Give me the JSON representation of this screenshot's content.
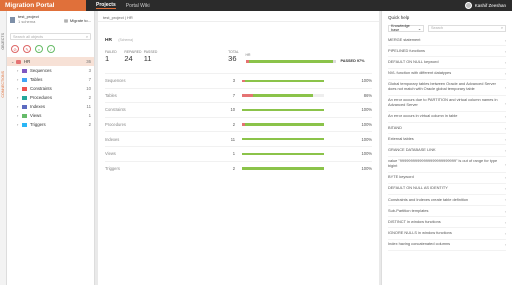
{
  "app": {
    "title": "Migration Portal"
  },
  "nav": [
    {
      "label": "Projects"
    },
    {
      "label": "Portal Wiki"
    }
  ],
  "user": {
    "name": "Kashif Zeeshan"
  },
  "side_tabs": [
    "OBJECTS",
    "CONNECTIONS"
  ],
  "project": {
    "name": "test_project",
    "sub": "1 schema",
    "migrate_label": "Migrate to..."
  },
  "search": {
    "placeholder": "Search all objects"
  },
  "tree": {
    "root": {
      "label": "HR",
      "count": "36"
    },
    "items": [
      {
        "label": "Sequences",
        "count": "3"
      },
      {
        "label": "Tables",
        "count": "7"
      },
      {
        "label": "Constraints",
        "count": "10"
      },
      {
        "label": "Procedures",
        "count": "2"
      },
      {
        "label": "Indexes",
        "count": "11"
      },
      {
        "label": "Views",
        "count": "1"
      },
      {
        "label": "Triggers",
        "count": "2"
      }
    ]
  },
  "breadcrumb": "test_project  |  HR",
  "schema": {
    "title": "HR",
    "subtitle": "(Schema)",
    "failed_label": "FAILED",
    "failed": "1",
    "repaired_label": "REPAIRED",
    "repaired": "24",
    "passed_label": "PASSED",
    "passed": "11",
    "total_label": "TOTAL",
    "total": "36",
    "hr_label": "HR",
    "passed_pct_label": "PASSED 97%",
    "passed_fraction": 0.97
  },
  "rows": [
    {
      "name": "Sequences",
      "count": "3",
      "pct": "100%",
      "fraction": 1.0,
      "failed_fraction": 0.04
    },
    {
      "name": "Tables",
      "count": "7",
      "pct": "86%",
      "fraction": 0.86,
      "failed_fraction": 0.14
    },
    {
      "name": "Constraints",
      "count": "10",
      "pct": "100%",
      "fraction": 1.0,
      "failed_fraction": 0.0
    },
    {
      "name": "Procedures",
      "count": "2",
      "pct": "100%",
      "fraction": 1.0,
      "failed_fraction": 0.04
    },
    {
      "name": "Indexes",
      "count": "11",
      "pct": "100%",
      "fraction": 1.0,
      "failed_fraction": 0.0
    },
    {
      "name": "Views",
      "count": "1",
      "pct": "100%",
      "fraction": 1.0,
      "failed_fraction": 0.0
    },
    {
      "name": "Triggers",
      "count": "2",
      "pct": "100%",
      "fraction": 1.0,
      "failed_fraction": 0.0
    }
  ],
  "quickhelp": {
    "title": "Quick help",
    "kb_select": "Knowledge base",
    "search_placeholder": "Search",
    "items": [
      "MERGE statement",
      "PIPELINED functions",
      "DEFAULT ON NULL keyword",
      "NVL function with different datatypes",
      "Global temporary tables between Oracle and Advanced Server does not match with Oracle global temporary table",
      "An error occurs due to PARTITION and virtual column names in Advanced Server",
      "An error occurs in virtual column in table",
      "BITAND",
      "External tables",
      "GRANCE DATABASE LINK",
      "value \"99999999999999999999999999\" is out of range for type bigint",
      "BYTE keyword",
      "DEFAULT ON NULL AS IDENTITY",
      "Constraints and Indexes create table definition",
      "Sub-Partition templates",
      "DISTINCT in window functions",
      "IGNORE NULLS in window functions",
      "Index having concatenated columns"
    ]
  },
  "colors": {
    "brand": "#e0703a",
    "passed": "#8bc34a",
    "failed": "#e57373"
  }
}
